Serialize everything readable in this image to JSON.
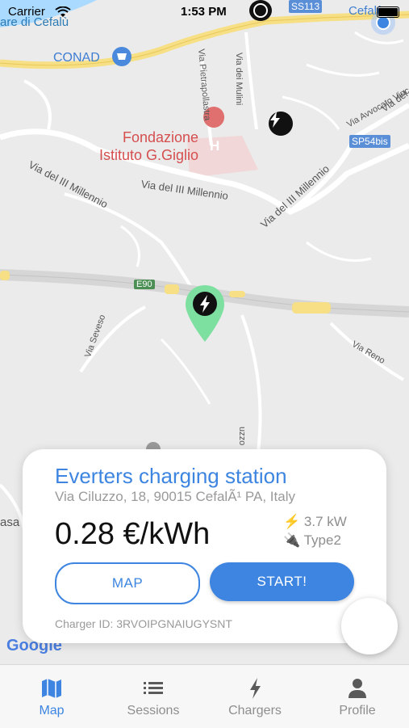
{
  "status_bar": {
    "carrier": "Carrier",
    "time": "1:53 PM"
  },
  "map": {
    "labels": {
      "cefalu_top": "are di Cefalù",
      "conad": "CONAD",
      "fondazione_line1": "Fondazione",
      "fondazione_line2": "Istituto G.Giglio",
      "via_millennio_1": "Via del III Millennio",
      "via_millennio_2": "Via del III Millennio",
      "via_millennio_3": "Via del III Millennio",
      "via_pietrapollastra": "Via Pietrapollastra",
      "via_mulini": "Via dei Mulini",
      "via_avvocato": "Via Avvocato Vinc",
      "via_del": "Via del",
      "sp54bis": "SP54bis",
      "ss113": "SS113",
      "cefalu_right": "Cefalù",
      "e90": "E90",
      "via_seveso": "Via Seveso",
      "via_reno": "Via Reno",
      "ciluzzo_fragment": "uzzo",
      "casa_fragment": "asa",
      "google": "Google"
    },
    "pin_color": "#7ee0a0",
    "marker_color": "#111111"
  },
  "station_card": {
    "name": "Everters charging station",
    "address": "Via Ciluzzo, 18, 90015 CefalÃ¹ PA, Italy",
    "price": "0.28 €/kWh",
    "power": "3.7 kW",
    "connector": "Type2",
    "map_button": "MAP",
    "start_button": "START!",
    "charger_id": "Charger ID: 3RVOIPGNAIUGYSNT",
    "accent_color": "#3d85e0"
  },
  "tab_bar": {
    "tabs": [
      {
        "label": "Map",
        "icon": "map-icon",
        "active": true
      },
      {
        "label": "Sessions",
        "icon": "list-icon",
        "active": false
      },
      {
        "label": "Chargers",
        "icon": "bolt-icon",
        "active": false
      },
      {
        "label": "Profile",
        "icon": "person-icon",
        "active": false
      }
    ]
  }
}
